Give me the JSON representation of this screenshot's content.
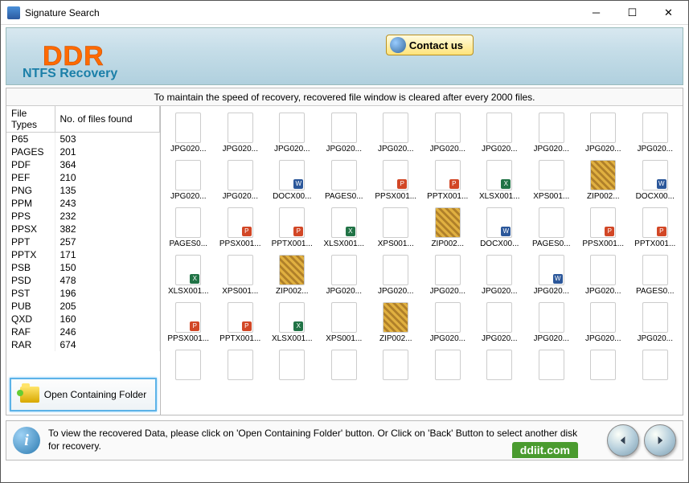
{
  "window": {
    "title": "Signature Search"
  },
  "banner": {
    "logo": "DDR",
    "subtitle": "NTFS Recovery",
    "contact_label": "Contact us"
  },
  "status_message": "To maintain the speed of recovery, recovered file window is cleared after every 2000 files.",
  "file_types_header": {
    "col1": "File Types",
    "col2": "No. of files found"
  },
  "file_types": [
    {
      "ext": "P65",
      "count": 503
    },
    {
      "ext": "PAGES",
      "count": 201
    },
    {
      "ext": "PDF",
      "count": 364
    },
    {
      "ext": "PEF",
      "count": 210
    },
    {
      "ext": "PNG",
      "count": 135
    },
    {
      "ext": "PPM",
      "count": 243
    },
    {
      "ext": "PPS",
      "count": 232
    },
    {
      "ext": "PPSX",
      "count": 382
    },
    {
      "ext": "PPT",
      "count": 257
    },
    {
      "ext": "PPTX",
      "count": 171
    },
    {
      "ext": "PSB",
      "count": 150
    },
    {
      "ext": "PSD",
      "count": 478
    },
    {
      "ext": "PST",
      "count": 196
    },
    {
      "ext": "PUB",
      "count": 205
    },
    {
      "ext": "QXD",
      "count": 160
    },
    {
      "ext": "RAF",
      "count": 246
    },
    {
      "ext": "RAR",
      "count": 674
    }
  ],
  "open_folder_label": "Open Containing Folder",
  "files": [
    {
      "name": "JPG020...",
      "type": "jpg"
    },
    {
      "name": "JPG020...",
      "type": "jpg"
    },
    {
      "name": "JPG020...",
      "type": "jpg"
    },
    {
      "name": "JPG020...",
      "type": "jpg"
    },
    {
      "name": "JPG020...",
      "type": "jpg"
    },
    {
      "name": "JPG020...",
      "type": "jpg"
    },
    {
      "name": "JPG020...",
      "type": "jpg"
    },
    {
      "name": "JPG020...",
      "type": "jpg"
    },
    {
      "name": "JPG020...",
      "type": "jpg"
    },
    {
      "name": "JPG020...",
      "type": "jpg"
    },
    {
      "name": "JPG020...",
      "type": "jpg"
    },
    {
      "name": "JPG020...",
      "type": "jpg"
    },
    {
      "name": "DOCX00...",
      "type": "doc"
    },
    {
      "name": "PAGES0...",
      "type": "jpg"
    },
    {
      "name": "PPSX001...",
      "type": "pps"
    },
    {
      "name": "PPTX001...",
      "type": "ppt"
    },
    {
      "name": "XLSX001...",
      "type": "xls"
    },
    {
      "name": "XPS001...",
      "type": "jpg"
    },
    {
      "name": "ZIP002...",
      "type": "zip"
    },
    {
      "name": "DOCX00...",
      "type": "doc"
    },
    {
      "name": "PAGES0...",
      "type": "jpg"
    },
    {
      "name": "PPSX001...",
      "type": "pps"
    },
    {
      "name": "PPTX001...",
      "type": "ppt"
    },
    {
      "name": "XLSX001...",
      "type": "xls"
    },
    {
      "name": "XPS001...",
      "type": "jpg"
    },
    {
      "name": "ZIP002...",
      "type": "zip"
    },
    {
      "name": "DOCX00...",
      "type": "doc"
    },
    {
      "name": "PAGES0...",
      "type": "jpg"
    },
    {
      "name": "PPSX001...",
      "type": "pps"
    },
    {
      "name": "PPTX001...",
      "type": "ppt"
    },
    {
      "name": "XLSX001...",
      "type": "xls"
    },
    {
      "name": "XPS001...",
      "type": "jpg"
    },
    {
      "name": "ZIP002...",
      "type": "zip"
    },
    {
      "name": "JPG020...",
      "type": "jpg"
    },
    {
      "name": "JPG020...",
      "type": "jpg"
    },
    {
      "name": "JPG020...",
      "type": "jpg"
    },
    {
      "name": "JPG020...",
      "type": "jpg"
    },
    {
      "name": "JPG020...",
      "type": "doc"
    },
    {
      "name": "JPG020...",
      "type": "jpg"
    },
    {
      "name": "PAGES0...",
      "type": "jpg"
    },
    {
      "name": "PPSX001...",
      "type": "pps"
    },
    {
      "name": "PPTX001...",
      "type": "ppt"
    },
    {
      "name": "XLSX001...",
      "type": "xls"
    },
    {
      "name": "XPS001...",
      "type": "jpg"
    },
    {
      "name": "ZIP002...",
      "type": "zip"
    },
    {
      "name": "JPG020...",
      "type": "jpg"
    },
    {
      "name": "JPG020...",
      "type": "jpg"
    },
    {
      "name": "JPG020...",
      "type": "jpg"
    },
    {
      "name": "JPG020...",
      "type": "jpg"
    },
    {
      "name": "JPG020...",
      "type": "jpg"
    },
    {
      "name": "",
      "type": "jpg"
    },
    {
      "name": "",
      "type": "jpg"
    },
    {
      "name": "",
      "type": "jpg"
    },
    {
      "name": "",
      "type": "jpg"
    },
    {
      "name": "",
      "type": "jpg"
    },
    {
      "name": "",
      "type": "jpg"
    },
    {
      "name": "",
      "type": "jpg"
    },
    {
      "name": "",
      "type": "jpg"
    },
    {
      "name": "",
      "type": "jpg"
    },
    {
      "name": "",
      "type": "jpg"
    }
  ],
  "footer": {
    "text": "To view the recovered Data, please click on 'Open Containing Folder' button. Or Click on 'Back' Button to select another disk for recovery.",
    "badge": "ddiit.com"
  }
}
